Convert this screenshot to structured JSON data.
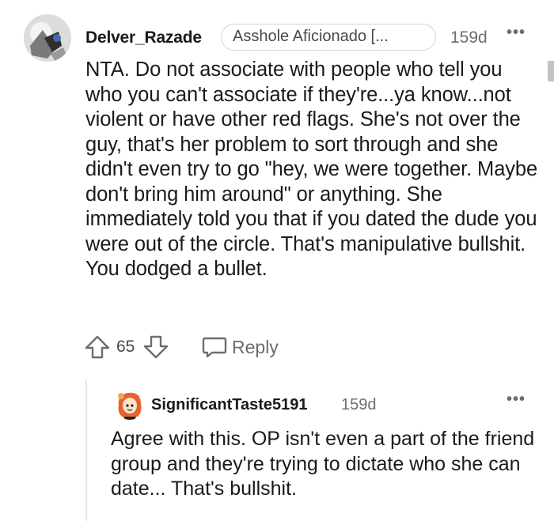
{
  "comment": {
    "username": "Delver_Razade",
    "flair": "Asshole Aficionado [...",
    "age": "159d",
    "more": "•••",
    "body": "NTA. Do not associate with people who tell you who you can't associate if they're...ya know...not violent or have other red flags. She's not over the guy, that's her problem to sort through and she didn't even try to go \"hey, we were together. Maybe don't bring him around\" or anything. She immediately told you that if you dated the dude you were out of the circle. That's manipulative bullshit. You dodged a bullet.",
    "score": "65",
    "reply_label": "Reply",
    "icons": {
      "upvote": "upvote-arrow-icon",
      "downvote": "downvote-arrow-icon",
      "reply": "speech-bubble-icon",
      "avatar": "user-avatar"
    }
  },
  "reply": {
    "username": "SignificantTaste5191",
    "age": "159d",
    "more": "•••",
    "body": "Agree with this. OP isn't even a part of the friend group and they're trying to dictate who she can date... That's bullshit.",
    "icons": {
      "avatar": "snoo-avatar-orange-hair"
    }
  },
  "colors": {
    "text": "#1a1a1b",
    "meta": "#6b6e71",
    "flair_border": "#d0d4d8",
    "thread_line": "#e4e6e8"
  }
}
